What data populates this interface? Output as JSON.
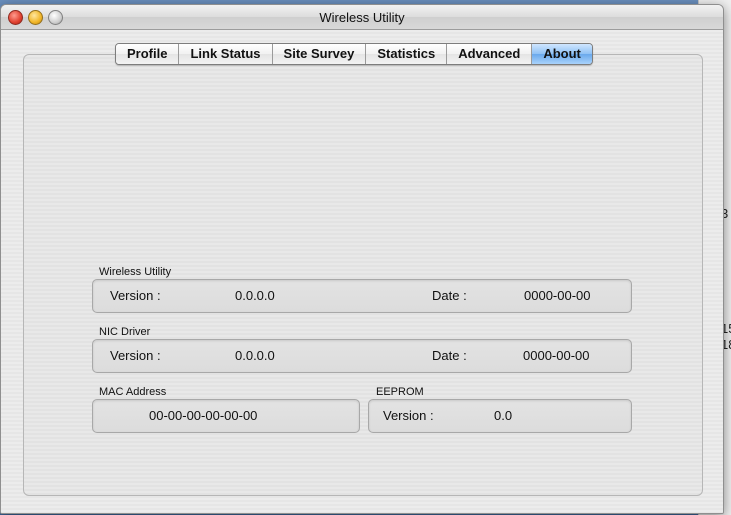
{
  "window": {
    "title": "Wireless Utility",
    "buttons": [
      "close",
      "minimize",
      "zoom"
    ]
  },
  "background": {
    "fragments": [
      "3",
      "15",
      "18"
    ]
  },
  "tabs": [
    {
      "label": "Profile",
      "active": false
    },
    {
      "label": "Link Status",
      "active": false
    },
    {
      "label": "Site Survey",
      "active": false
    },
    {
      "label": "Statistics",
      "active": false
    },
    {
      "label": "Advanced",
      "active": false
    },
    {
      "label": "About",
      "active": true
    }
  ],
  "about": {
    "wireless_utility": {
      "group_label": "Wireless Utility",
      "version_label": "Version :",
      "version": "0.0.0.0",
      "date_label": "Date :",
      "date": "0000-00-00"
    },
    "nic_driver": {
      "group_label": "NIC Driver",
      "version_label": "Version :",
      "version": "0.0.0.0",
      "date_label": "Date :",
      "date": "0000-00-00"
    },
    "mac_address": {
      "group_label": "MAC Address",
      "value": "00-00-00-00-00-00"
    },
    "eeprom": {
      "group_label": "EEPROM",
      "version_label": "Version :",
      "version": "0.0"
    }
  },
  "colors": {
    "active_tab": "#8fc1f5",
    "desktop": "#4e76a8"
  }
}
